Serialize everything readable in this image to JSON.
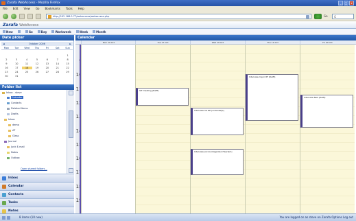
{
  "window": {
    "title": "Zarafa WebAccess - Mozilla Firefox"
  },
  "menu": [
    "File",
    "Edit",
    "View",
    "Go",
    "Bookmarks",
    "Tools",
    "Help"
  ],
  "browser": {
    "url": "http://192.168.0.77/webaccess/webaccess.php",
    "go_label": "Go",
    "search_placeholder": "G"
  },
  "app": {
    "logo": "Zarafa",
    "logo_sub": "WebAccess"
  },
  "toolbar": {
    "new": "New",
    "delete": "",
    "goto": "Go",
    "day": "Day",
    "workweek": "Workweek",
    "week": "Week",
    "month": "Month"
  },
  "panels": {
    "date_picker": "Date picker",
    "calendar": "Calendar",
    "folder_list": "Folder list"
  },
  "minical": {
    "month": "October 2006",
    "days": [
      "Mon",
      "Tue",
      "Wed",
      "Thu",
      "Fri",
      "Sat",
      "Sun"
    ],
    "dates": [
      "",
      "",
      "",
      "",
      "",
      "",
      "1",
      "2",
      "3",
      "4",
      "5",
      "6",
      "7",
      "8",
      "9",
      "10",
      "11",
      "12",
      "13",
      "14",
      "15",
      "16",
      "17",
      "18",
      "19",
      "20",
      "21",
      "22",
      "23",
      "24",
      "25",
      "26",
      "27",
      "28",
      "29",
      "30",
      "31"
    ]
  },
  "folders": {
    "user": "Inbox - steve",
    "items": [
      {
        "label": "Calendar",
        "icon": "calendar-icon",
        "selected": true
      },
      {
        "label": "Contacts",
        "icon": "contacts-icon"
      },
      {
        "label": "Deleted Items",
        "icon": "deleted-icon"
      },
      {
        "label": "Drafts",
        "icon": "drafts-icon"
      },
      {
        "label": "Inbox",
        "icon": "folder-icon"
      },
      {
        "label": "demo",
        "icon": "folder-icon"
      },
      {
        "label": "AT",
        "icon": "folder-icon"
      },
      {
        "label": "Glass",
        "icon": "folder-icon"
      },
      {
        "label": "Journal",
        "icon": "journal-icon"
      },
      {
        "label": "Junk E-mail",
        "icon": "folder-icon"
      },
      {
        "label": "Notes",
        "icon": "notes-icon"
      },
      {
        "label": "Outbox",
        "icon": "outbox-icon"
      }
    ],
    "shared_link": "Open shared folders..."
  },
  "nav": [
    {
      "label": "Inbox",
      "icon": "mail-icon"
    },
    {
      "label": "Calendar",
      "icon": "calendar-icon"
    },
    {
      "label": "Contacts",
      "icon": "contacts-icon"
    },
    {
      "label": "Tasks",
      "icon": "tasks-icon"
    },
    {
      "label": "Notes",
      "icon": "notes-icon"
    }
  ],
  "calendar": {
    "days": [
      "Mon 16 Oct",
      "Tue 17 Oct",
      "Wed 18 Oct",
      "Thu 19 Oct",
      "Fri 20 Oct"
    ],
    "hours": [
      "9",
      "10",
      "11",
      "12",
      "13",
      "14",
      "15",
      "16",
      "17",
      "18",
      "19"
    ],
    "events": [
      {
        "text": "IAT meeting (Delft)"
      },
      {
        "text": "Interview Ins RE (onderdwijs)"
      },
      {
        "text": "Interview Ing in RT (Delft)"
      },
      {
        "text": "Interview Ned (Delft)"
      },
      {
        "text": "Interview (Accountagenten Haarlem)"
      }
    ]
  },
  "status": {
    "left": "8 items (10 new)",
    "right": "You are logged on as steve on Zarafa  Options  Log out"
  }
}
